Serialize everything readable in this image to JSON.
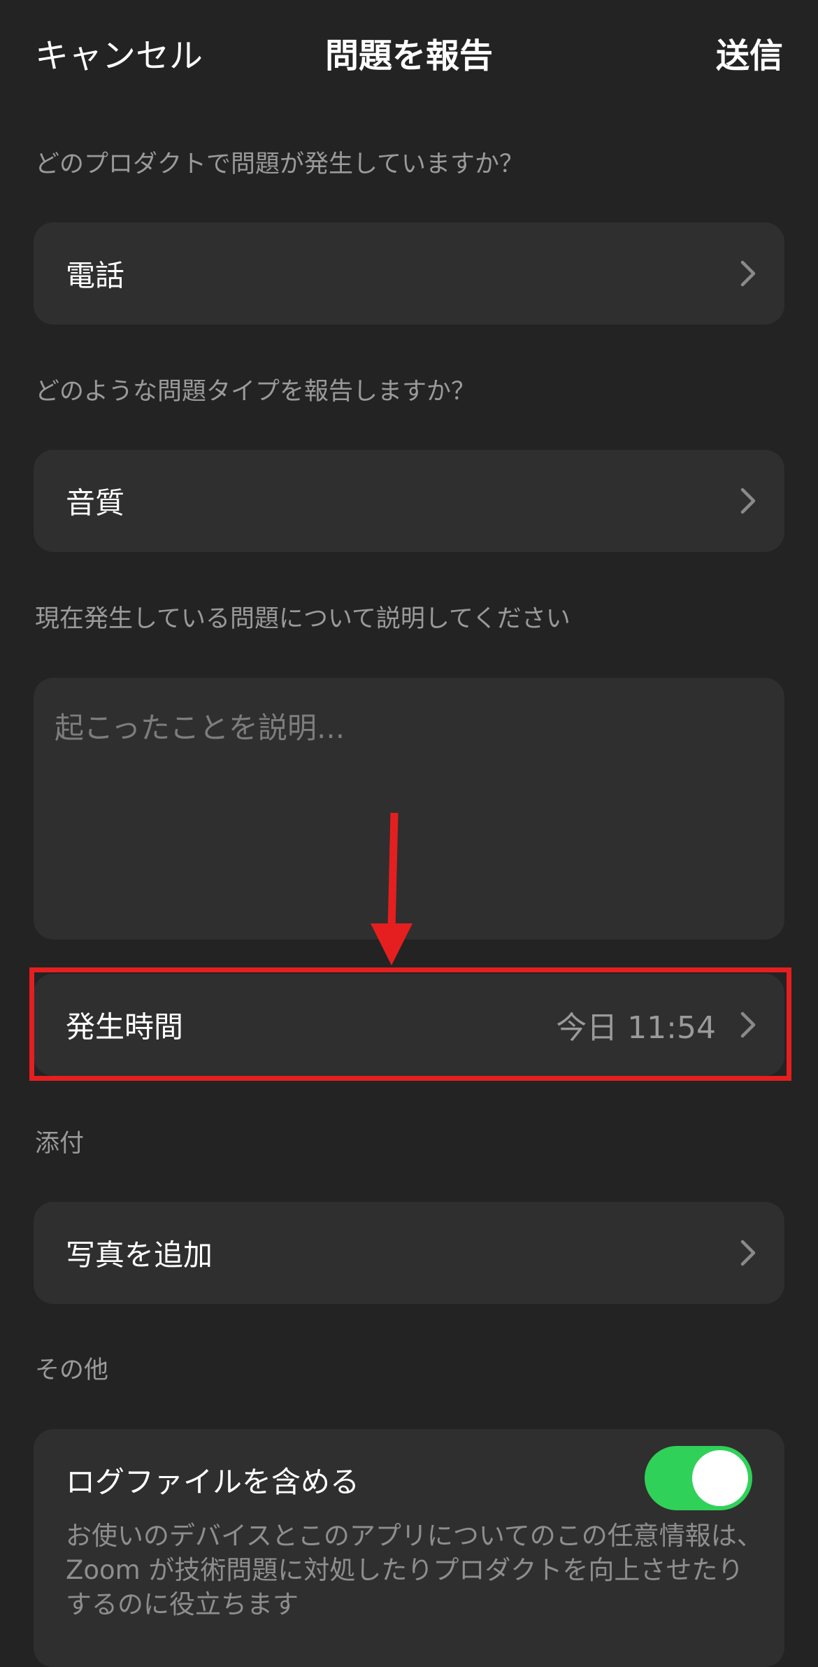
{
  "nav": {
    "cancel_label": "キャンセル",
    "title": "問題を報告",
    "send_label": "送信"
  },
  "product": {
    "question": "どのプロダクトで問題が発生していますか？",
    "value": "電話"
  },
  "issue_type": {
    "question": "どのような問題タイプを報告しますか？",
    "value": "音質"
  },
  "description": {
    "question": "現在発生している問題について説明してください",
    "placeholder": "起こったことを説明..."
  },
  "occurrence": {
    "label": "発生時間",
    "value": "今日 11:54"
  },
  "attachment": {
    "section_label": "添付",
    "add_photo_label": "写真を追加"
  },
  "other": {
    "section_label": "その他",
    "log_title": "ログファイルを含める",
    "log_desc": "お使いのデバイスとこのアプリについてのこの任意情報は、Zoom が技術問題に対処したりプロダクトを向上させたりするのに役立ちます",
    "log_enabled": true
  },
  "colors": {
    "background": "#232323",
    "card": "#2f2f2f",
    "toggle_on": "#30d158",
    "annotation_red": "#e51f1f"
  },
  "icons": {
    "chevron": "chevron-right-icon"
  }
}
